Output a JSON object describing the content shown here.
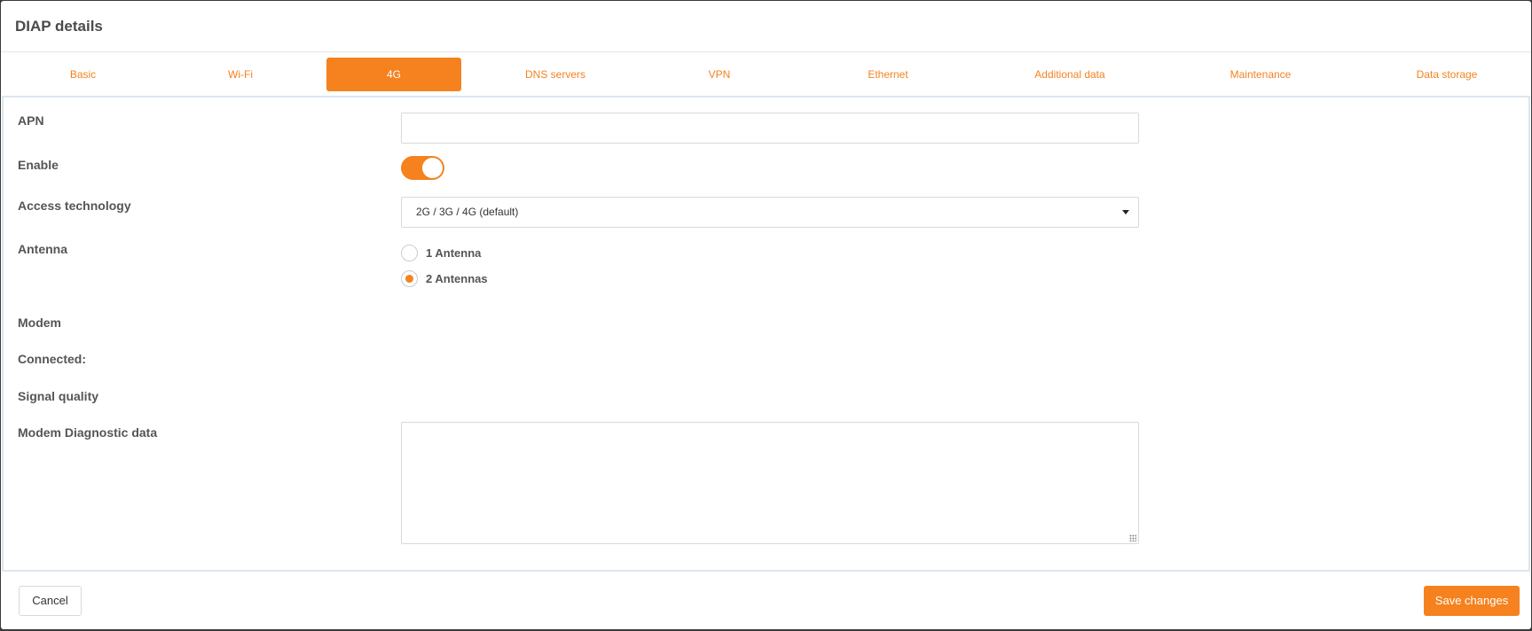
{
  "dialog": {
    "title": "DIAP details"
  },
  "tabs": [
    {
      "label": "Basic",
      "active": false
    },
    {
      "label": "Wi-Fi",
      "active": false
    },
    {
      "label": "4G",
      "active": true
    },
    {
      "label": "DNS servers",
      "active": false
    },
    {
      "label": "VPN",
      "active": false
    },
    {
      "label": "Ethernet",
      "active": false
    },
    {
      "label": "Additional data",
      "active": false
    },
    {
      "label": "Maintenance",
      "active": false
    },
    {
      "label": "Data storage",
      "active": false
    }
  ],
  "form": {
    "apn": {
      "label": "APN",
      "value": ""
    },
    "enable": {
      "label": "Enable",
      "on": true
    },
    "access_technology": {
      "label": "Access technology",
      "selected": "2G / 3G / 4G (default)"
    },
    "antenna": {
      "label": "Antenna",
      "options": [
        {
          "label": "1 Antenna",
          "checked": false
        },
        {
          "label": "2 Antennas",
          "checked": true
        }
      ]
    },
    "modem": {
      "label": "Modem"
    },
    "connected": {
      "label": "Connected:"
    },
    "signal_quality": {
      "label": "Signal quality"
    },
    "diagnostic": {
      "label": "Modem Diagnostic data",
      "value": ""
    }
  },
  "footer": {
    "cancel_label": "Cancel",
    "save_label": "Save changes"
  },
  "colors": {
    "accent": "#f5821f"
  }
}
